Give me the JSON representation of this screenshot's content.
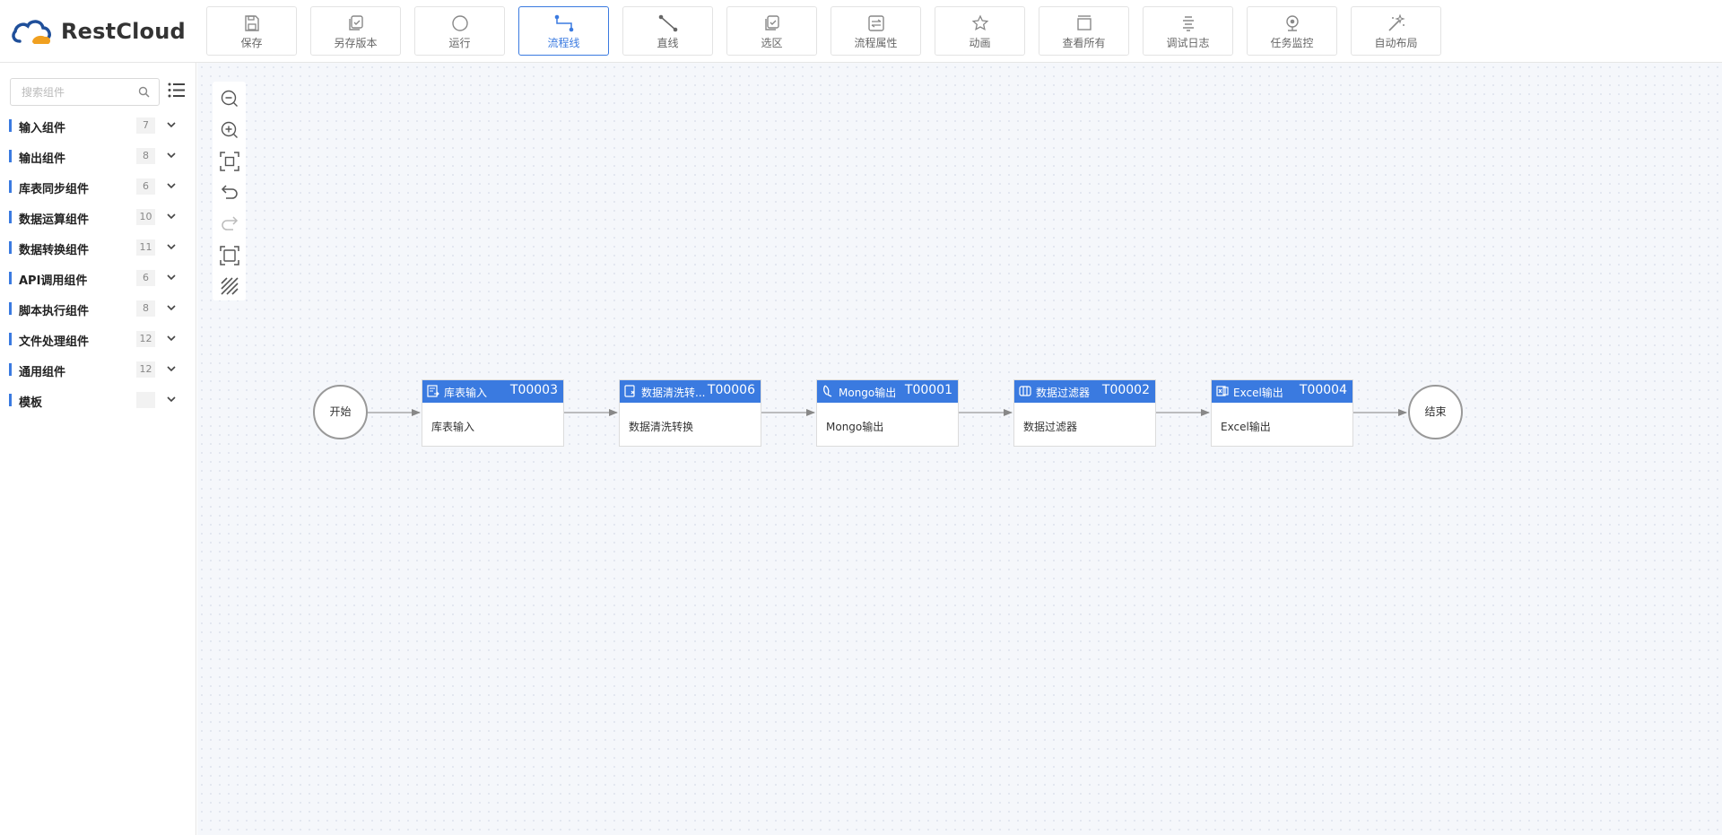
{
  "app": {
    "brand": "RestCloud",
    "brand_colors": {
      "primary": "#3a7ae0",
      "logo_blue": "#1f4f9a",
      "logo_orange": "#f0a020"
    }
  },
  "toolbar": [
    {
      "label": "保存",
      "icon": "save-icon"
    },
    {
      "label": "另存版本",
      "icon": "save-version-icon"
    },
    {
      "label": "运行",
      "icon": "run-icon"
    },
    {
      "label": "流程线",
      "icon": "flow-line-icon",
      "active": true
    },
    {
      "label": "直线",
      "icon": "straight-line-icon"
    },
    {
      "label": "选区",
      "icon": "select-area-icon"
    },
    {
      "label": "流程属性",
      "icon": "flow-properties-icon"
    },
    {
      "label": "动画",
      "icon": "animation-icon"
    },
    {
      "label": "查看所有",
      "icon": "view-all-icon"
    },
    {
      "label": "调试日志",
      "icon": "debug-log-icon"
    },
    {
      "label": "任务监控",
      "icon": "task-monitor-icon"
    },
    {
      "label": "自动布局",
      "icon": "auto-layout-icon"
    }
  ],
  "sidebar": {
    "search_placeholder": "搜索组件",
    "categories": [
      {
        "label": "输入组件",
        "count": "7"
      },
      {
        "label": "输出组件",
        "count": "8"
      },
      {
        "label": "库表同步组件",
        "count": "6"
      },
      {
        "label": "数据运算组件",
        "count": "10"
      },
      {
        "label": "数据转换组件",
        "count": "11"
      },
      {
        "label": "API调用组件",
        "count": "6"
      },
      {
        "label": "脚本执行组件",
        "count": "8"
      },
      {
        "label": "文件处理组件",
        "count": "12"
      },
      {
        "label": "通用组件",
        "count": "12"
      },
      {
        "label": "模板",
        "count": ""
      }
    ]
  },
  "canvas": {
    "zoom_tools": [
      "zoom-out-icon",
      "zoom-in-icon",
      "fit-view-icon",
      "undo-icon",
      "redo-icon",
      "fullscreen-icon",
      "grid-toggle-icon"
    ],
    "start_label": "开始",
    "end_label": "结束",
    "tasks": [
      {
        "title": "库表输入",
        "code": "T00003",
        "body": "库表输入",
        "icon": "table-input-icon"
      },
      {
        "title": "数据清洗转...",
        "code": "T00006",
        "body": "数据清洗转换",
        "icon": "data-clean-icon"
      },
      {
        "title": "Mongo输出",
        "code": "T00001",
        "body": "Mongo输出",
        "icon": "mongo-icon"
      },
      {
        "title": "数据过滤器",
        "code": "T00002",
        "body": "数据过滤器",
        "icon": "filter-icon"
      },
      {
        "title": "Excel输出",
        "code": "T00004",
        "body": "Excel输出",
        "icon": "excel-icon"
      }
    ]
  }
}
